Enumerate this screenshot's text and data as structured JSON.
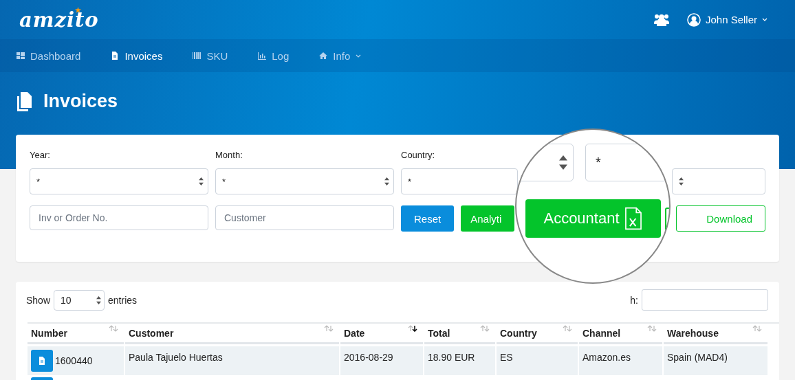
{
  "header": {
    "logo": "amzito",
    "user": "John Seller"
  },
  "nav": [
    {
      "label": "Dashboard",
      "selected": false,
      "caret": false
    },
    {
      "label": "Invoices",
      "selected": true,
      "caret": false
    },
    {
      "label": "SKU",
      "selected": false,
      "caret": false
    },
    {
      "label": "Log",
      "selected": false,
      "caret": false
    },
    {
      "label": "Info",
      "selected": false,
      "caret": true
    }
  ],
  "page_title": "Invoices",
  "filters": {
    "selects": [
      {
        "label": "Year:",
        "value": "*"
      },
      {
        "label": "Month:",
        "value": "*"
      },
      {
        "label": "Country:",
        "value": "*"
      }
    ],
    "inputs": [
      {
        "placeholder": "Inv or Order No."
      },
      {
        "placeholder": "Customer"
      }
    ],
    "buttons": [
      {
        "label": "Reset",
        "kind": "primary"
      },
      {
        "label": "Analyti",
        "kind": "success"
      }
    ],
    "download": "Download"
  },
  "magnifier": {
    "select_value": "*",
    "button": "Accountant"
  },
  "table": {
    "show_label": "Show",
    "page_size": "10",
    "entries_label": "entries",
    "search_label": "h:",
    "columns": [
      {
        "label": "Number",
        "sorted": false
      },
      {
        "label": "Customer",
        "sorted": false
      },
      {
        "label": "Date",
        "sorted": true
      },
      {
        "label": "Total",
        "sorted": false
      },
      {
        "label": "Country",
        "sorted": false
      },
      {
        "label": "Channel",
        "sorted": false
      },
      {
        "label": "Warehouse",
        "sorted": false
      }
    ],
    "rows": [
      {
        "cells": [
          "1600440",
          "Paula Tajuelo Huertas",
          "2016-08-29",
          "18.90 EUR",
          "ES",
          "Amazon.es",
          "Spain (MAD4)"
        ]
      }
    ]
  }
}
